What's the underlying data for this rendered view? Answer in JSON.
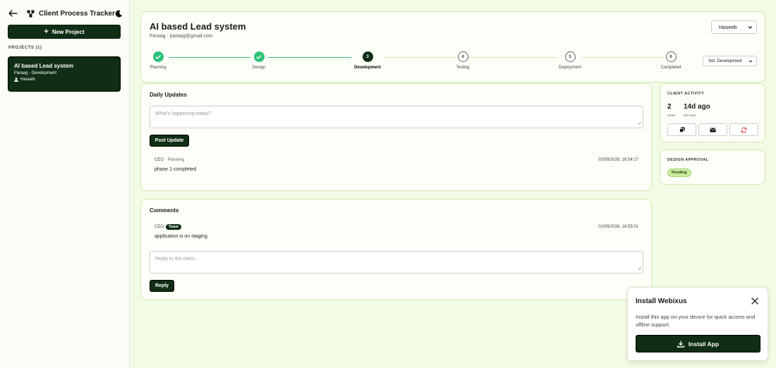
{
  "app": {
    "title": "Client Process Tracker"
  },
  "sidebar": {
    "new_project_label": "New Project",
    "projects_label": "PROJECTS (1)",
    "projects": [
      {
        "title": "AI based Lead system",
        "subtitle": "Paraag - Development",
        "user": "Haseeb"
      }
    ]
  },
  "project": {
    "title": "AI based Lead system",
    "subtitle": "Paraag - paraag@gmail.com",
    "owner_select": "Haseeb",
    "stage_select": "Set: Development",
    "steps": [
      {
        "label": "Planning",
        "state": "done"
      },
      {
        "label": "Design",
        "state": "done"
      },
      {
        "number": "3",
        "label": "Development",
        "state": "current"
      },
      {
        "number": "4",
        "label": "Testing",
        "state": "todo"
      },
      {
        "number": "5",
        "label": "Deployment",
        "state": "todo"
      },
      {
        "number": "6",
        "label": "Completed",
        "state": "todo"
      }
    ]
  },
  "updates": {
    "title": "Daily Updates",
    "placeholder": "What's happening today?",
    "post_label": "Post Update",
    "entries": [
      {
        "author": "CEO",
        "phase": "· Planning",
        "time": "02/09/2026, 16:54:17",
        "text": "phase 1 completed"
      }
    ]
  },
  "comments": {
    "title": "Comments",
    "entries": [
      {
        "author": "CEO",
        "badge": "Team",
        "time": "02/09/2026, 16:55:01",
        "text": "application is on staging."
      }
    ],
    "placeholder": "Reply to the client...",
    "reply_label": "Reply"
  },
  "activity": {
    "title": "CLIENT ACTIVITY",
    "views_value": "2",
    "views_label": "views",
    "last_seen_value": "14d ago",
    "last_seen_label": "last seen"
  },
  "approval": {
    "title": "DESIGN APPROVAL",
    "status": "Pending"
  },
  "install": {
    "title": "Install Webixus",
    "text": "Install this app on your device for quick access and offline support.",
    "button_label": "Install App"
  },
  "colors": {
    "primary_dark": "#0f2e14",
    "step_done": "#2cc27a",
    "page_bg": "#f3fbe6",
    "card_border": "#cfe8ad",
    "badge_green": "#c9ec9a",
    "refresh_red": "#d63a3a"
  },
  "icons": {
    "back": "arrow-left-icon",
    "brand": "network-icon",
    "theme": "moon-icon",
    "copy": "copy-icon",
    "email": "mail-icon",
    "refresh": "refresh-icon",
    "close": "close-icon",
    "download": "download-icon"
  }
}
